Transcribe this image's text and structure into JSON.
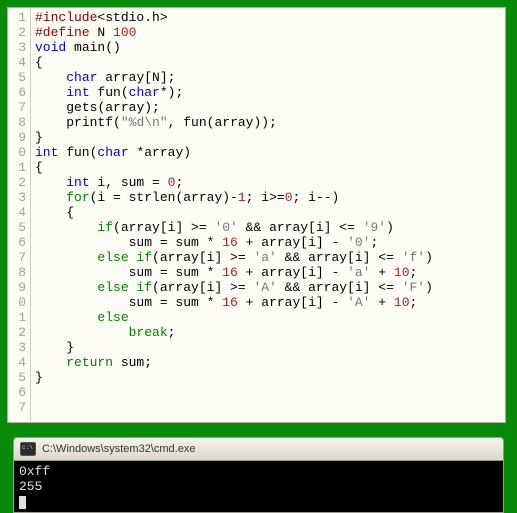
{
  "gutter": [
    "1",
    "2",
    "3",
    "4",
    "5",
    "6",
    "7",
    "8",
    "9",
    "0",
    "1",
    "2",
    "3",
    "4",
    "5",
    "6",
    "7",
    "8",
    "9",
    "0",
    "1",
    "2",
    "3",
    "4",
    "5",
    "6",
    "7"
  ],
  "code": {
    "l1": {
      "pp": "#include",
      "rest": "<stdio.h>"
    },
    "l2": {
      "pp": "#define",
      "name": " N ",
      "val": "100"
    },
    "l3": {
      "kw": "void",
      "fn": " main()"
    },
    "l4": "{",
    "l5": {
      "indent": "    ",
      "kw": "char",
      "rest": " array[N];"
    },
    "l6": {
      "indent": "    ",
      "kw": "int",
      "rest": " fun(",
      "kw2": "char",
      "rest2": "*);"
    },
    "l7": {
      "indent": "    ",
      "fn": "gets",
      "rest": "(array);"
    },
    "l8": {
      "indent": "    ",
      "fn": "printf",
      "open": "(",
      "str": "\"%d\\n\"",
      "rest": ", fun(array));"
    },
    "l9": "}",
    "l10": "",
    "l11": {
      "kw": "int",
      "fn": " fun(",
      "kw2": "char",
      "rest": " *array)"
    },
    "l12": "{",
    "l13": {
      "indent": "    ",
      "kw": "int",
      "rest": " i, sum = ",
      "num": "0",
      "semi": ";"
    },
    "l14": {
      "indent": "    ",
      "kw": "for",
      "rest": "(i = strlen(array)-",
      "n1": "1",
      "mid": "; i>=",
      "n2": "0",
      "end": "; i--)"
    },
    "l15": {
      "indent": "    ",
      "brace": "{"
    },
    "l16": {
      "indent": "        ",
      "kw": "if",
      "open": "(array[i] >= ",
      "s1": "'0'",
      "mid": " && array[i] <= ",
      "s2": "'9'",
      "close": ")"
    },
    "l17": {
      "indent": "            ",
      "text": "sum = sum * ",
      "n1": "16",
      "mid": " + array[i] - ",
      "s1": "'0'",
      "semi": ";"
    },
    "l18": {
      "indent": "        ",
      "kw": "else if",
      "open": "(array[i] >= ",
      "s1": "'a'",
      "mid": " && array[i] <= ",
      "s2": "'f'",
      "close": ")"
    },
    "l19": {
      "indent": "            ",
      "text": "sum = sum * ",
      "n1": "16",
      "mid": " + array[i] - ",
      "s1": "'a'",
      "plus": " + ",
      "n2": "10",
      "semi": ";"
    },
    "l20": {
      "indent": "        ",
      "kw": "else if",
      "open": "(array[i] >= ",
      "s1": "'A'",
      "mid": " && array[i] <= ",
      "s2": "'F'",
      "close": ")"
    },
    "l21": {
      "indent": "            ",
      "text": "sum = sum * ",
      "n1": "16",
      "mid": " + array[i] - ",
      "s1": "'A'",
      "plus": " + ",
      "n2": "10",
      "semi": ";"
    },
    "l22": {
      "indent": "        ",
      "kw": "else"
    },
    "l23": {
      "indent": "            ",
      "kw": "break",
      "semi": ";"
    },
    "l24": {
      "indent": "    ",
      "brace": "}"
    },
    "l25": {
      "indent": "    ",
      "kw": "return",
      "rest": " sum;"
    },
    "l26": "}",
    "l27": ""
  },
  "console": {
    "title": "C:\\Windows\\system32\\cmd.exe",
    "line1": "0xff",
    "line2": "255"
  }
}
